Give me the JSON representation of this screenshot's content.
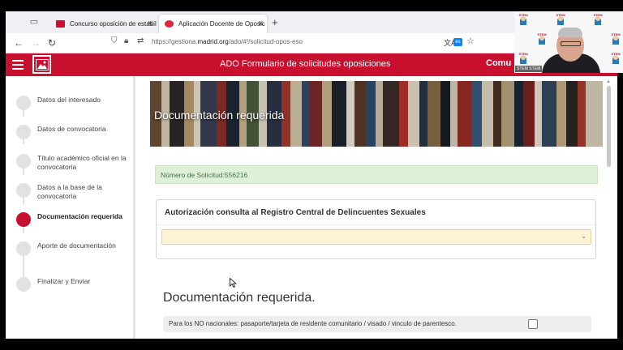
{
  "browser": {
    "tabs": [
      {
        "title": "Concurso oposición de estabil",
        "active": false
      },
      {
        "title": "Aplicación Docente de Oposic",
        "active": true
      }
    ],
    "url_prefix": "https://gestiona.",
    "url_domain": "madrid.org",
    "url_suffix": "/ado/#!/solicitud-opos-eso",
    "lang_badge": "es"
  },
  "header": {
    "title": "ADO Formulario de solicitudes oposiciones",
    "right_text": "Comu",
    "color": "#c8102e"
  },
  "sidebar": {
    "steps": [
      {
        "label": "Datos del interesado",
        "active": false
      },
      {
        "label": "Datos de convocatoria",
        "active": false
      },
      {
        "label": "Título académico oficial en la convocatoria",
        "active": false
      },
      {
        "label": "Datos a la base de la convocatoria",
        "active": false
      },
      {
        "label": "Documentación requerida",
        "active": true
      },
      {
        "label": "Aporte de documentación",
        "active": false
      },
      {
        "label": "Finalizar y Enviar",
        "active": false
      }
    ]
  },
  "main": {
    "banner_title": "Documentación requerida",
    "solicitud_label": "Número de Solicitud:",
    "solicitud_number": "556216",
    "panel_title": "Autorización consulta al Registro Central de Delincuentes Sexuales",
    "select_value": "",
    "section_title": "Documentación requerida.",
    "doc_rows": [
      {
        "text": "Para los NO nacionales: pasaporte/tarjeta de residente comunitario / visado / vinculo de parentesco.",
        "checked": false
      }
    ]
  },
  "webcam": {
    "logo_text": "STEM",
    "name_label": "STEM STEM"
  }
}
